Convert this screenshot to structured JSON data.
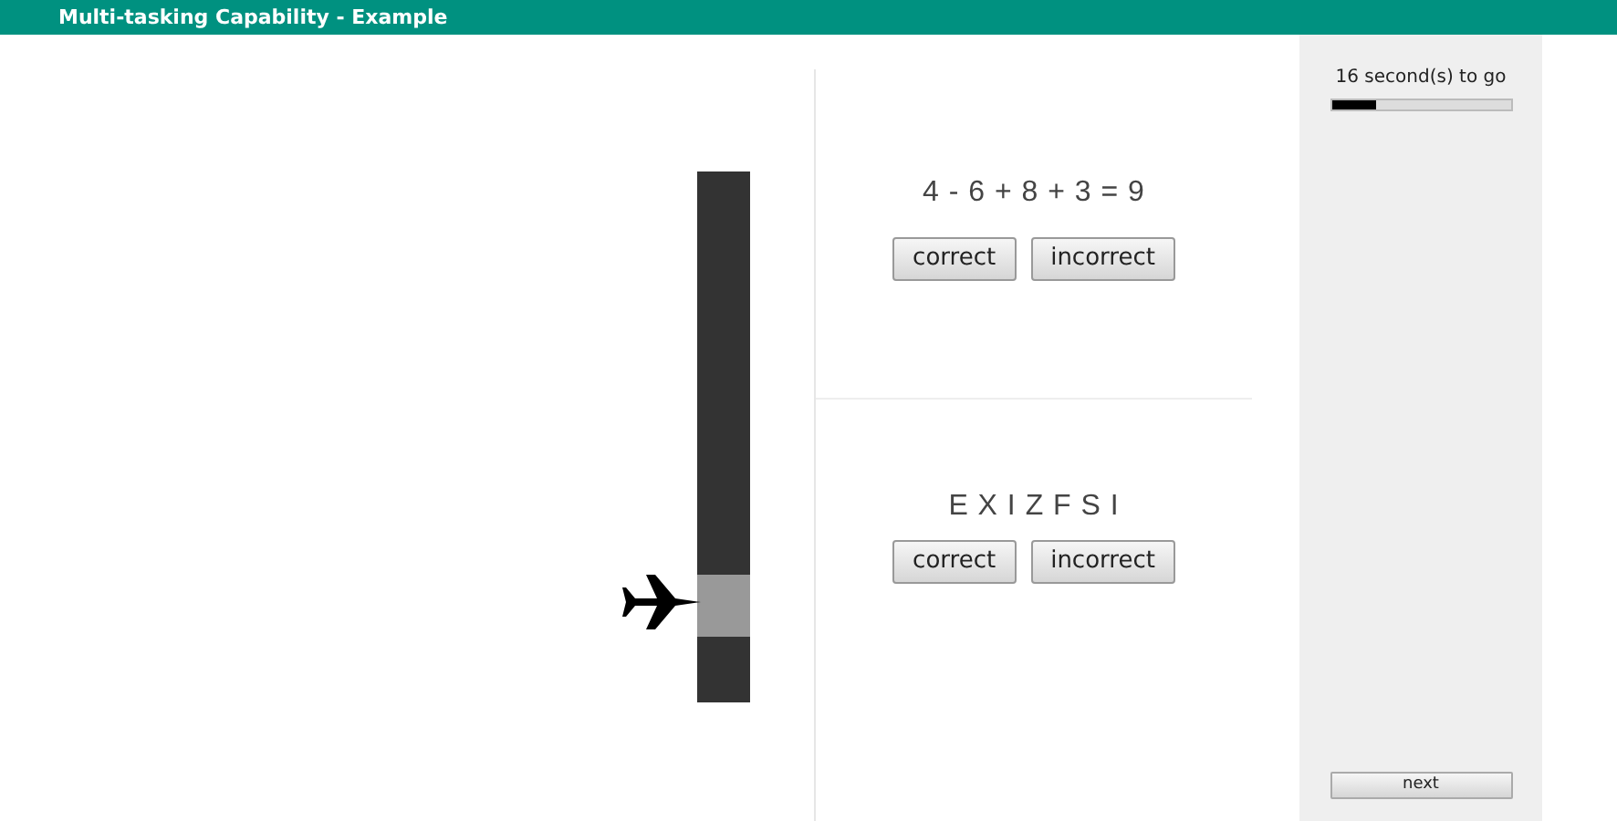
{
  "window": {
    "title": "Multi-tasking Capability - Example"
  },
  "tasks": [
    {
      "prompt": "4 - 6 + 8 + 3 = 9",
      "kind": "arithmetic",
      "buttons": [
        "correct",
        "incorrect"
      ]
    },
    {
      "prompt": "E X I Z F S I",
      "kind": "letters",
      "buttons": [
        "correct",
        "incorrect"
      ]
    }
  ],
  "timer": {
    "text": "16 second(s) to go",
    "level": 0.25
  },
  "next_button": "next"
}
